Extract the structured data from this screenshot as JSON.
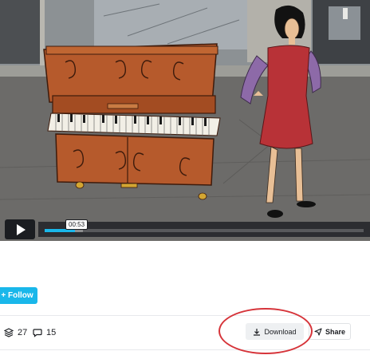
{
  "player": {
    "current_time": "00:53",
    "progress_fraction": 0.095,
    "buffered_fraction": 0.12,
    "play_icon": "play-icon"
  },
  "channel": {
    "follow_label": "+ Follow"
  },
  "stats": {
    "layers_count": "27",
    "comments_count": "15"
  },
  "actions": {
    "download_label": "Download",
    "share_label": "Share"
  },
  "colors": {
    "accent": "#19b7ea",
    "annotation_circle": "#d6343a"
  }
}
